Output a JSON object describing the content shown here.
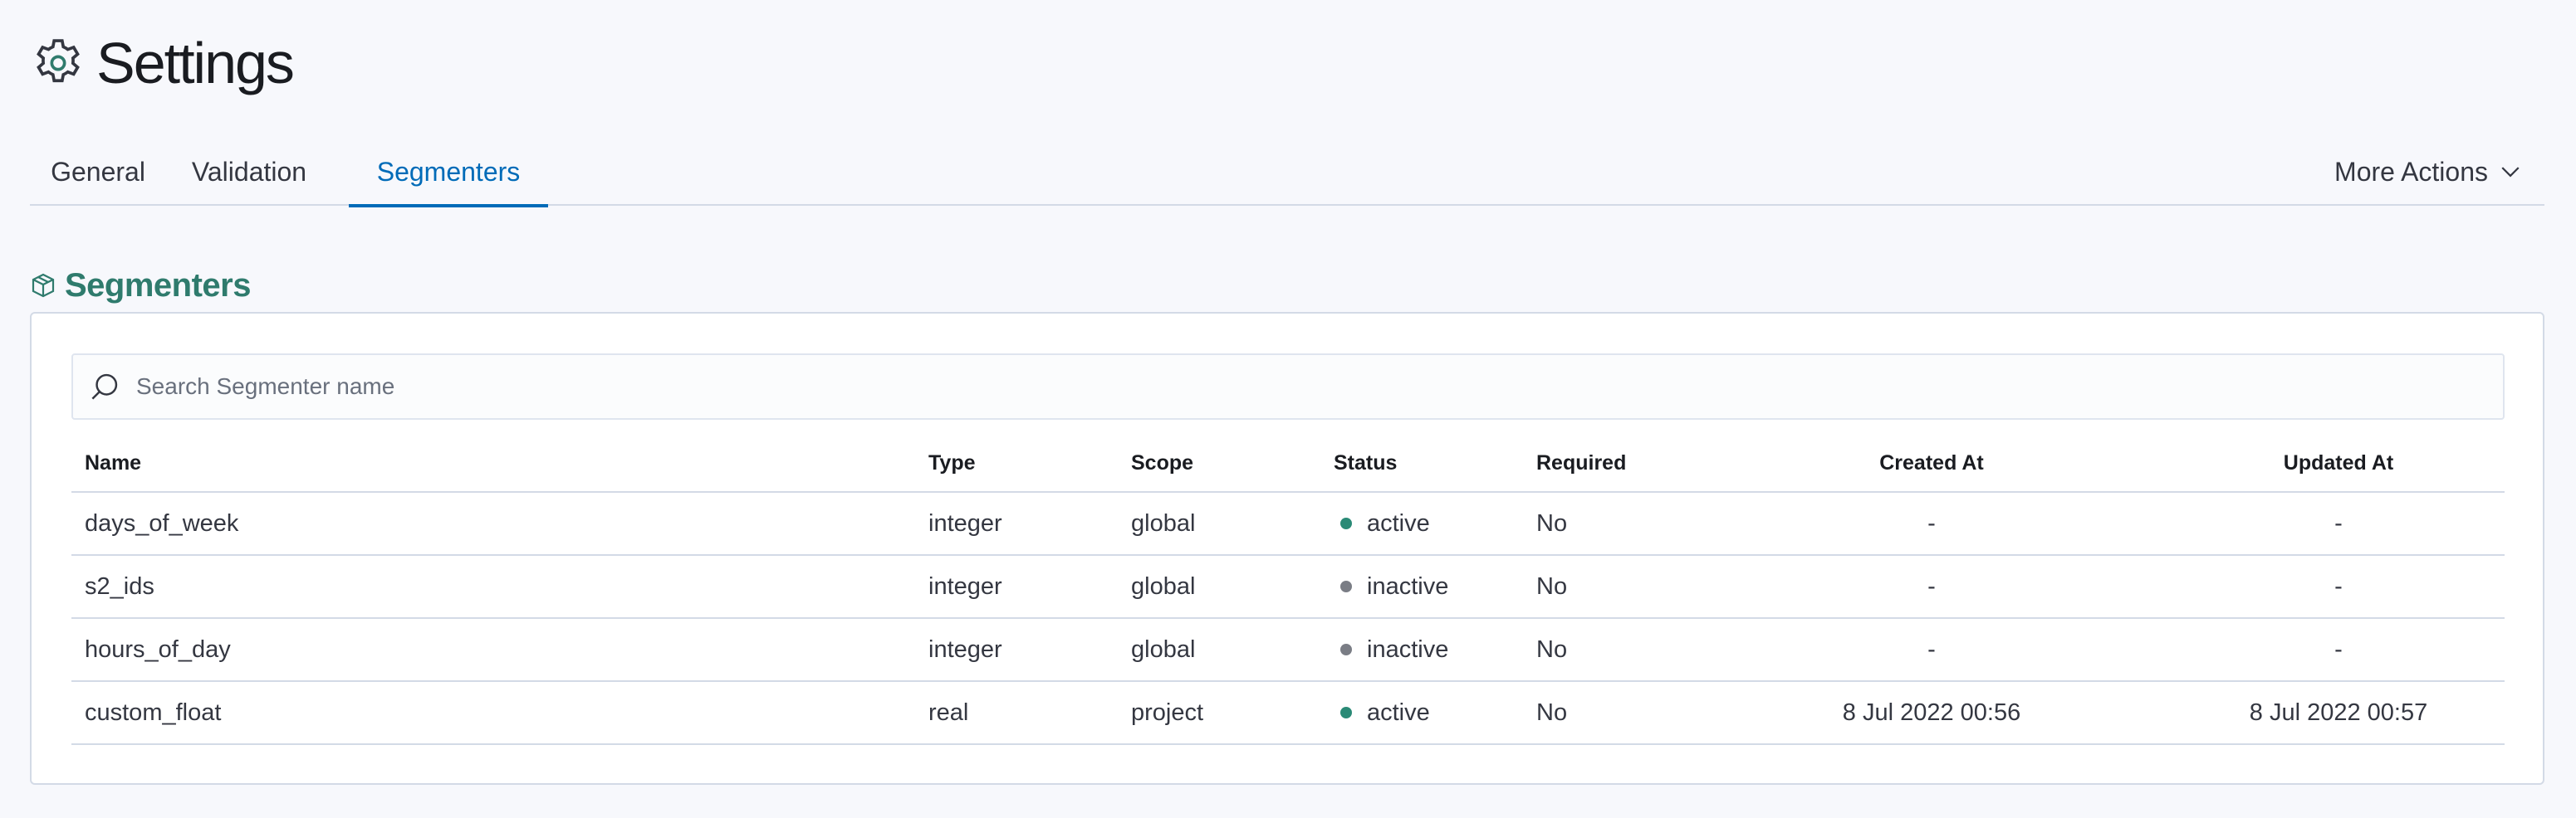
{
  "header": {
    "title": "Settings",
    "icon": "gear-icon"
  },
  "tabs": [
    {
      "label": "General",
      "active": false
    },
    {
      "label": "Validation",
      "active": false
    },
    {
      "label": "Segmenters",
      "active": true
    }
  ],
  "more_actions": {
    "label": "More Actions",
    "icon": "chevron-down-icon"
  },
  "section": {
    "title": "Segmenters",
    "icon": "cube-icon"
  },
  "search": {
    "placeholder": "Search Segmenter name",
    "value": ""
  },
  "table": {
    "columns": [
      "Name",
      "Type",
      "Scope",
      "Status",
      "Required",
      "Created At",
      "Updated At"
    ],
    "rows": [
      {
        "name": "days_of_week",
        "type": "integer",
        "scope": "global",
        "status": "active",
        "required": "No",
        "created_at": "-",
        "updated_at": "-"
      },
      {
        "name": "s2_ids",
        "type": "integer",
        "scope": "global",
        "status": "inactive",
        "required": "No",
        "created_at": "-",
        "updated_at": "-"
      },
      {
        "name": "hours_of_day",
        "type": "integer",
        "scope": "global",
        "status": "inactive",
        "required": "No",
        "created_at": "-",
        "updated_at": "-"
      },
      {
        "name": "custom_float",
        "type": "real",
        "scope": "project",
        "status": "active",
        "required": "No",
        "created_at": "8 Jul 2022 00:56",
        "updated_at": "8 Jul 2022 00:57"
      }
    ]
  },
  "colors": {
    "accent": "#006bb8",
    "section_title": "#2f7b6d",
    "status_active": "#2a8a76",
    "status_inactive": "#7a7d85"
  }
}
